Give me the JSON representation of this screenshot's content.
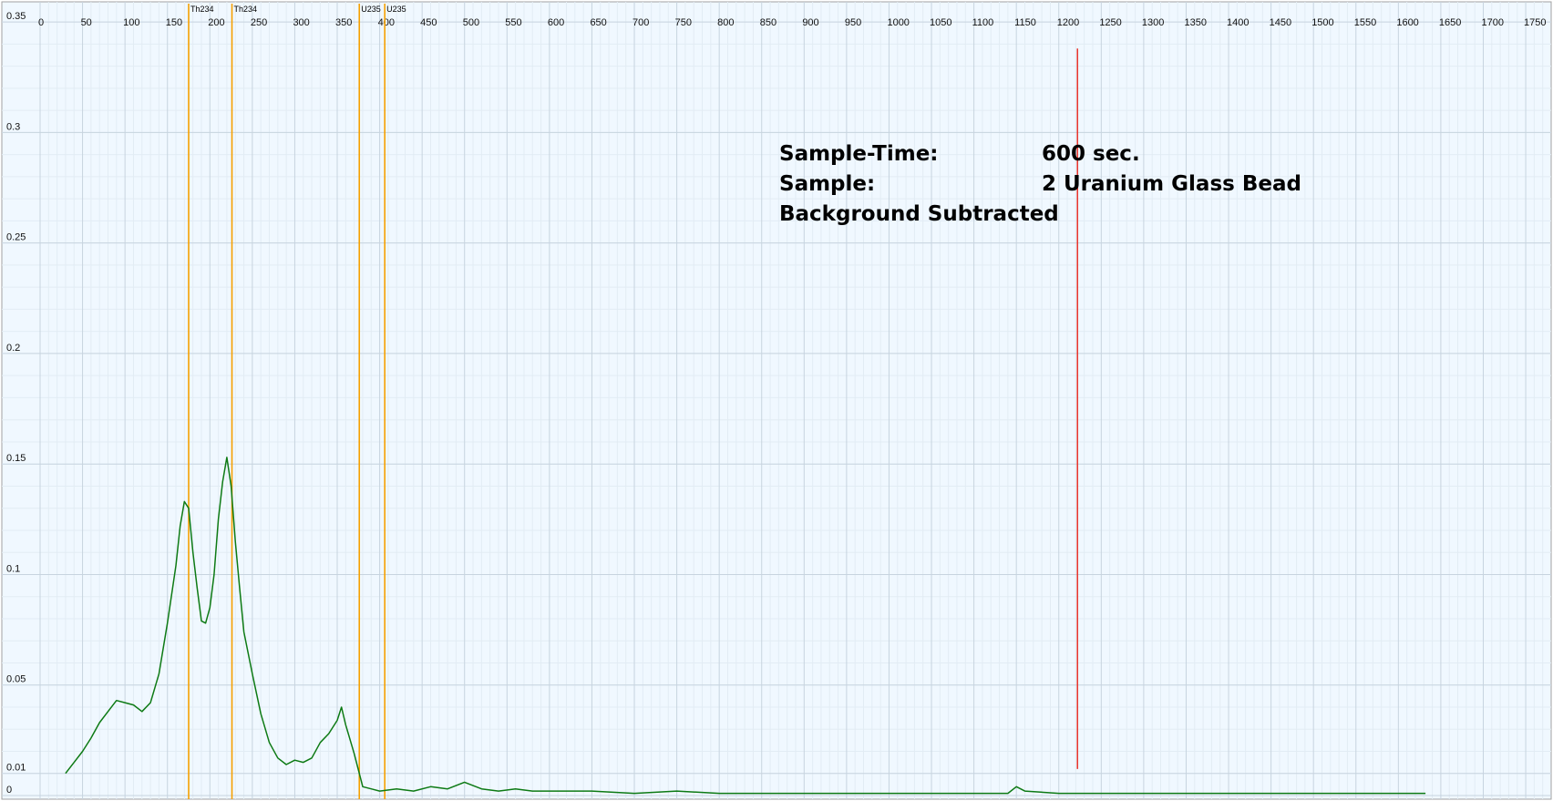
{
  "chart_data": {
    "type": "line",
    "title": "",
    "xlabel": "",
    "ylabel": "",
    "grid": true,
    "xlim": [
      0,
      1780
    ],
    "ylim": [
      0,
      0.355
    ],
    "x_ticks": [
      0,
      50,
      100,
      150,
      200,
      250,
      300,
      350,
      400,
      450,
      500,
      550,
      600,
      650,
      700,
      750,
      800,
      850,
      900,
      950,
      1000,
      1050,
      1100,
      1150,
      1200,
      1250,
      1300,
      1350,
      1400,
      1450,
      1500,
      1550,
      1600,
      1650,
      1700,
      1750
    ],
    "x_tick_labels": [
      "0",
      "50",
      "100",
      "150",
      "200",
      "250",
      "300",
      "350",
      "400",
      "450",
      "500",
      "550",
      "600",
      "650",
      "700",
      "750",
      "800",
      "850",
      "900",
      "950",
      "1000",
      "1050",
      "1100",
      "1150",
      "1200",
      "1250",
      "1300",
      "1350",
      "1400",
      "1450",
      "1500",
      "1550",
      "1600",
      "1650",
      "1700",
      "1750"
    ],
    "y_ticks": [
      0,
      0.01,
      0.05,
      0.1,
      0.15,
      0.2,
      0.25,
      0.3,
      0.35
    ],
    "y_tick_labels": [
      "0",
      "0.01",
      "0.05",
      "0.1",
      "0.15",
      "0.2",
      "0.25",
      "0.3",
      "0.35"
    ],
    "series": [
      {
        "color": "#0d7a14",
        "points": [
          [
            30,
            0.01
          ],
          [
            40,
            0.015
          ],
          [
            50,
            0.02
          ],
          [
            60,
            0.026
          ],
          [
            70,
            0.033
          ],
          [
            80,
            0.038
          ],
          [
            90,
            0.043
          ],
          [
            100,
            0.042
          ],
          [
            110,
            0.041
          ],
          [
            120,
            0.038
          ],
          [
            130,
            0.042
          ],
          [
            140,
            0.055
          ],
          [
            150,
            0.078
          ],
          [
            160,
            0.104
          ],
          [
            165,
            0.122
          ],
          [
            170,
            0.133
          ],
          [
            175,
            0.13
          ],
          [
            180,
            0.11
          ],
          [
            185,
            0.094
          ],
          [
            190,
            0.079
          ],
          [
            195,
            0.078
          ],
          [
            200,
            0.085
          ],
          [
            205,
            0.1
          ],
          [
            210,
            0.125
          ],
          [
            215,
            0.142
          ],
          [
            220,
            0.153
          ],
          [
            225,
            0.14
          ],
          [
            230,
            0.115
          ],
          [
            235,
            0.094
          ],
          [
            240,
            0.074
          ],
          [
            250,
            0.055
          ],
          [
            260,
            0.037
          ],
          [
            270,
            0.024
          ],
          [
            280,
            0.017
          ],
          [
            290,
            0.014
          ],
          [
            300,
            0.016
          ],
          [
            310,
            0.015
          ],
          [
            320,
            0.017
          ],
          [
            330,
            0.024
          ],
          [
            340,
            0.028
          ],
          [
            350,
            0.034
          ],
          [
            355,
            0.04
          ],
          [
            360,
            0.032
          ],
          [
            370,
            0.019
          ],
          [
            380,
            0.004
          ],
          [
            390,
            0.003
          ],
          [
            400,
            0.002
          ],
          [
            420,
            0.003
          ],
          [
            440,
            0.002
          ],
          [
            460,
            0.004
          ],
          [
            480,
            0.003
          ],
          [
            500,
            0.006
          ],
          [
            520,
            0.003
          ],
          [
            540,
            0.002
          ],
          [
            560,
            0.003
          ],
          [
            580,
            0.002
          ],
          [
            600,
            0.002
          ],
          [
            650,
            0.002
          ],
          [
            700,
            0.001
          ],
          [
            750,
            0.002
          ],
          [
            800,
            0.001
          ],
          [
            850,
            0.001
          ],
          [
            900,
            0.001
          ],
          [
            950,
            0.001
          ],
          [
            1000,
            0.001
          ],
          [
            1050,
            0.001
          ],
          [
            1100,
            0.001
          ],
          [
            1140,
            0.001
          ],
          [
            1150,
            0.004
          ],
          [
            1160,
            0.002
          ],
          [
            1200,
            0.001
          ],
          [
            1300,
            0.001
          ],
          [
            1400,
            0.001
          ],
          [
            1500,
            0.001
          ],
          [
            1600,
            0.001
          ],
          [
            1632,
            0.001
          ]
        ]
      }
    ],
    "markers": [
      {
        "x": 175,
        "label": "Th234",
        "color": "#f5a000"
      },
      {
        "x": 226,
        "label": "Th234",
        "color": "#f5a000"
      },
      {
        "x": 376,
        "label": "U235",
        "color": "#f5a000"
      },
      {
        "x": 406,
        "label": "U235",
        "color": "#f5a000"
      }
    ],
    "cursor": {
      "x": 1222,
      "ymin": 0.012,
      "ymax": 0.338,
      "color": "#e8342c"
    },
    "info_rows": [
      {
        "label": "Sample-Time:",
        "value": "600 sec."
      },
      {
        "label": "Sample:",
        "value": "2 Uranium Glass Bead"
      },
      {
        "label": "Background Subtracted",
        "value": ""
      }
    ]
  }
}
